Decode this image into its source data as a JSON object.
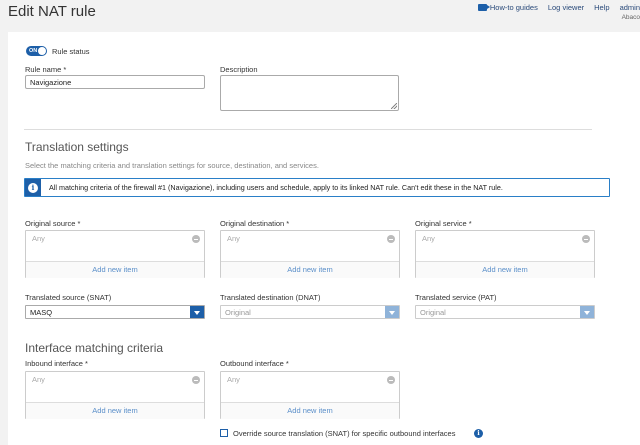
{
  "header": {
    "title": "Edit NAT rule",
    "links": {
      "how_to": "How-to guides",
      "log_viewer": "Log viewer",
      "help": "Help",
      "user": "admin"
    },
    "org": "Abaco"
  },
  "form": {
    "rule_status_label": "Rule status",
    "toggle_text": "ON",
    "rule_name_label": "Rule name *",
    "rule_name_value": "Navigazione",
    "description_label": "Description",
    "description_value": ""
  },
  "translation": {
    "title": "Translation settings",
    "subtitle": "Select the matching criteria and translation settings for source, destination, and services.",
    "info": "All matching criteria of the firewall #1 (Navigazione), including users and schedule, apply to its linked NAT rule. Can't edit these in the NAT rule.",
    "original_source_label": "Original source *",
    "original_destination_label": "Original destination *",
    "original_service_label": "Original service *",
    "any": "Any",
    "add_new_item": "Add new item",
    "translated_source_label": "Translated source (SNAT)",
    "translated_destination_label": "Translated destination (DNAT)",
    "translated_service_label": "Translated service (PAT)",
    "translated_source_value": "MASQ",
    "translated_destination_value": "Original",
    "translated_service_value": "Original"
  },
  "interface": {
    "title": "Interface matching criteria",
    "inbound_label": "Inbound interface *",
    "outbound_label": "Outbound interface *",
    "any": "Any",
    "add_new_item": "Add new item",
    "override_label": "Override source translation (SNAT) for specific outbound interfaces"
  },
  "colors": {
    "accent": "#1d5fa8",
    "info_border": "#2a7fc7",
    "link_muted": "#5b8fc9"
  }
}
